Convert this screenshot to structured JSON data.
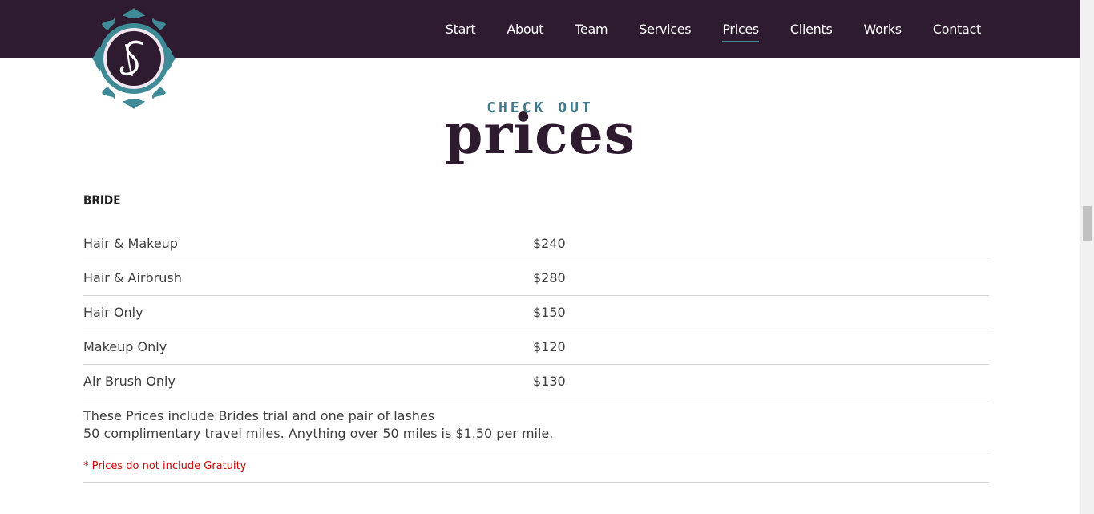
{
  "nav": {
    "items": [
      "Start",
      "About",
      "Team",
      "Services",
      "Prices",
      "Clients",
      "Works",
      "Contact"
    ],
    "active": "Prices"
  },
  "logo": {
    "icon": "ornamental-monogram-logo"
  },
  "section": {
    "eyebrow": "CHECK OUT",
    "title": "prices"
  },
  "pricing": {
    "category": "BRIDE",
    "rows": [
      {
        "item": "Hair & Makeup",
        "price": "$240"
      },
      {
        "item": "Hair & Airbrush",
        "price": "$280"
      },
      {
        "item": "Hair Only",
        "price": "$150"
      },
      {
        "item": "Makeup Only",
        "price": "$120"
      },
      {
        "item": "Air Brush Only",
        "price": "$130"
      }
    ],
    "notes": [
      "These Prices include Brides trial and one pair of lashes",
      "50 complimentary travel miles. Anything over 50 miles is $1.50 per mile."
    ],
    "gratuity_note": "* Prices do not include Gratuity"
  },
  "colors": {
    "nav_bg": "#2e1b30",
    "accent": "#3f8a97",
    "heading": "#2e1b30",
    "warning": "#d00000"
  }
}
